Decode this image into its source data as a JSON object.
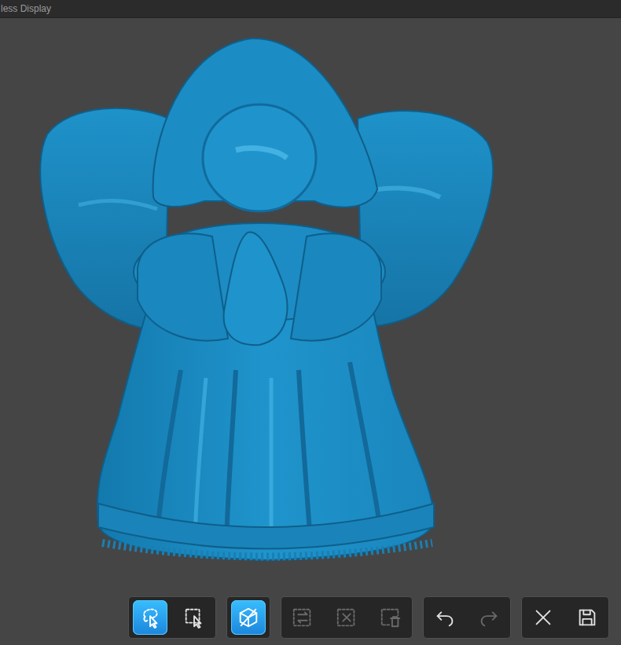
{
  "window": {
    "title": "less Display"
  },
  "toolbar": {
    "groups": [
      {
        "buttons": [
          {
            "selected": true,
            "disabled": false
          },
          {
            "selected": false,
            "disabled": false
          }
        ]
      },
      {
        "buttons": [
          {
            "selected": true,
            "disabled": false
          }
        ]
      },
      {
        "buttons": [
          {
            "selected": false,
            "disabled": true
          },
          {
            "selected": false,
            "disabled": true
          },
          {
            "selected": false,
            "disabled": true
          }
        ]
      },
      {
        "buttons": [
          {
            "selected": false,
            "disabled": false
          },
          {
            "selected": false,
            "disabled": true
          }
        ]
      },
      {
        "buttons": [
          {
            "selected": false,
            "disabled": false
          },
          {
            "selected": false,
            "disabled": false
          }
        ]
      }
    ]
  }
}
